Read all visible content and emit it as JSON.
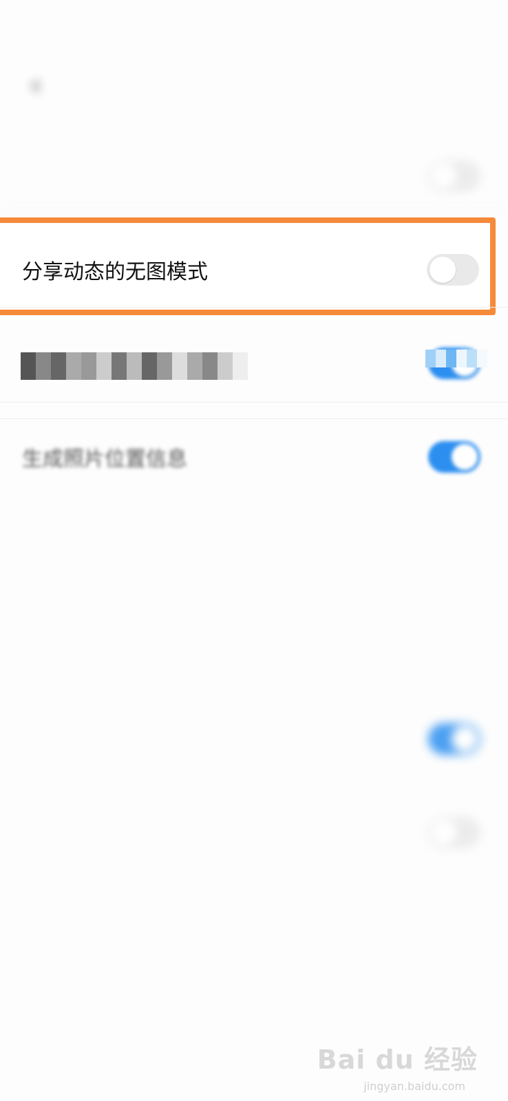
{
  "status_bar": {
    "left": "",
    "right": ""
  },
  "header": {
    "title": "",
    "back_icon": "chevron-left-icon"
  },
  "settings": {
    "row1": {
      "label": "",
      "toggle": "off"
    },
    "highlighted": {
      "label": "分享动态的无图模式",
      "toggle": "off"
    },
    "row3": {
      "label": "",
      "toggle": "on"
    },
    "row4": {
      "label": "生成照片位置信息",
      "toggle": "on"
    },
    "row5": {
      "label": "",
      "value": ""
    },
    "row6": {
      "label": "",
      "value": ""
    },
    "row7": {
      "label": "",
      "toggle": "on"
    },
    "row8": {
      "label": "",
      "toggle": "off"
    }
  },
  "watermark": {
    "brand": "Bai du 经验",
    "url": "jingyan.baidu.com"
  },
  "colors": {
    "highlight": "#f58a3a",
    "toggle_on": "#2c8ff0",
    "toggle_off": "#e9e9e9"
  }
}
